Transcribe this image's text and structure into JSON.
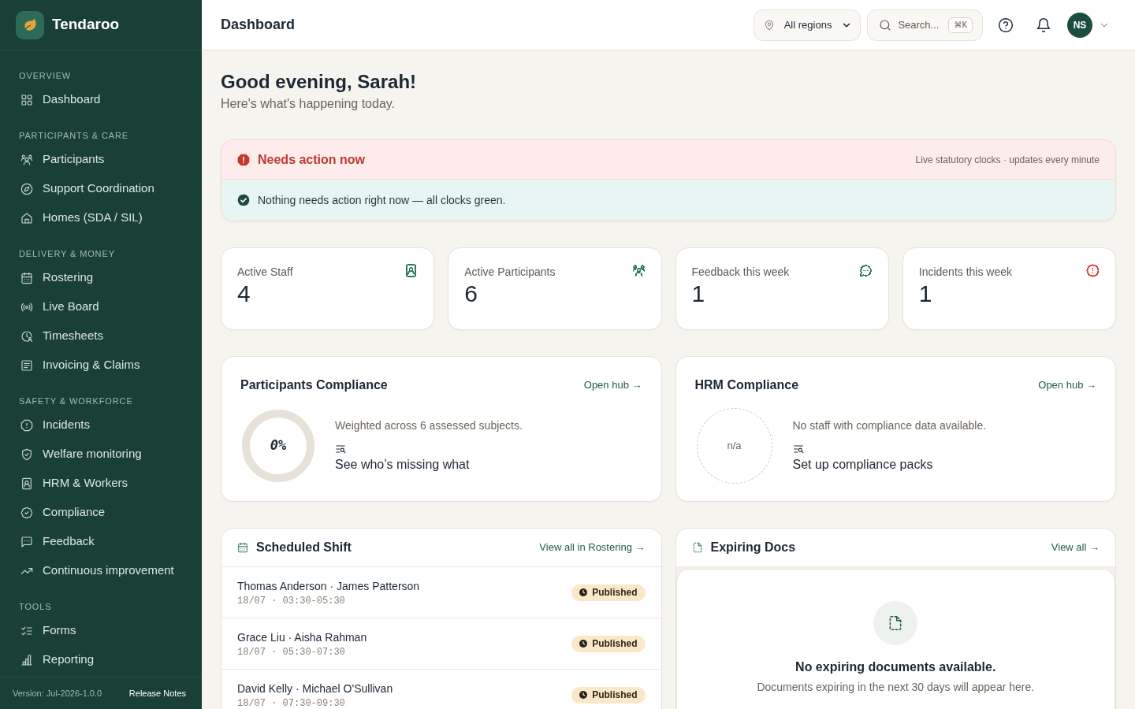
{
  "sidebar": {
    "brand": "Tendaroo",
    "sections": [
      {
        "title": "OVERVIEW",
        "items": [
          {
            "label": "Dashboard"
          }
        ]
      },
      {
        "title": "PARTICIPANTS & CARE",
        "items": [
          {
            "label": "Participants"
          },
          {
            "label": "Support Coordination"
          },
          {
            "label": "Homes (SDA / SIL)"
          }
        ]
      },
      {
        "title": "DELIVERY & MONEY",
        "items": [
          {
            "label": "Rostering"
          },
          {
            "label": "Live Board"
          },
          {
            "label": "Timesheets"
          },
          {
            "label": "Invoicing & Claims"
          }
        ]
      },
      {
        "title": "SAFETY & WORKFORCE",
        "items": [
          {
            "label": "Incidents"
          },
          {
            "label": "Welfare monitoring"
          },
          {
            "label": "HRM & Workers"
          },
          {
            "label": "Compliance"
          },
          {
            "label": "Feedback"
          },
          {
            "label": "Continuous improvement"
          }
        ]
      },
      {
        "title": "TOOLS",
        "items": [
          {
            "label": "Forms"
          },
          {
            "label": "Reporting"
          }
        ]
      }
    ],
    "footer": {
      "version": "Version: Jul-2026-1.0.0",
      "release_notes": "Release Notes"
    }
  },
  "header": {
    "title": "Dashboard",
    "region": "All regions",
    "search": {
      "label": "Search...",
      "shortcut": "⌘K"
    },
    "avatar": "NS"
  },
  "greeting": {
    "title": "Good evening, Sarah!",
    "subtitle": "Here's what's happening today."
  },
  "alert": {
    "title": "Needs action now",
    "note": "Live statutory clocks · updates every minute",
    "message": "Nothing needs action right now — all clocks green."
  },
  "stats": [
    {
      "label": "Active Staff",
      "value": "4",
      "color": "#2f7a5f"
    },
    {
      "label": "Active Participants",
      "value": "6",
      "color": "#2f7a5f"
    },
    {
      "label": "Feedback this week",
      "value": "1",
      "color": "#2f7a5f"
    },
    {
      "label": "Incidents this week",
      "value": "1",
      "color": "#d9443a"
    }
  ],
  "compliance": [
    {
      "title": "Participants Compliance",
      "link": "Open hub →",
      "kind": "ring",
      "level": 0,
      "value": "0%",
      "description": "Weighted across 6 assessed subjects.",
      "action": "See who’s missing what"
    },
    {
      "title": "HRM Compliance",
      "link": "Open hub →",
      "kind": "placeholder",
      "value": "n/a",
      "description": "No staff with compliance data available.",
      "action": "Set up compliance packs"
    }
  ],
  "shifts": {
    "title": "Scheduled Shift",
    "link": "View all in Rostering →",
    "rows": [
      {
        "names": "Thomas Anderson · James Patterson",
        "time": "18/07 · 03:30-05:30",
        "status": "Published"
      },
      {
        "names": "Grace Liu · Aisha Rahman",
        "time": "18/07 · 05:30-07:30",
        "status": "Published"
      },
      {
        "names": "David Kelly · Michael O'Sullivan",
        "time": "18/07 · 07:30-09:30",
        "status": "Published"
      }
    ]
  },
  "expiring_docs": {
    "title": "Expiring Docs",
    "link": "View all →",
    "empty_title": "No expiring documents available.",
    "empty_text": "Documents expiring in the next 30 days will appear here."
  }
}
